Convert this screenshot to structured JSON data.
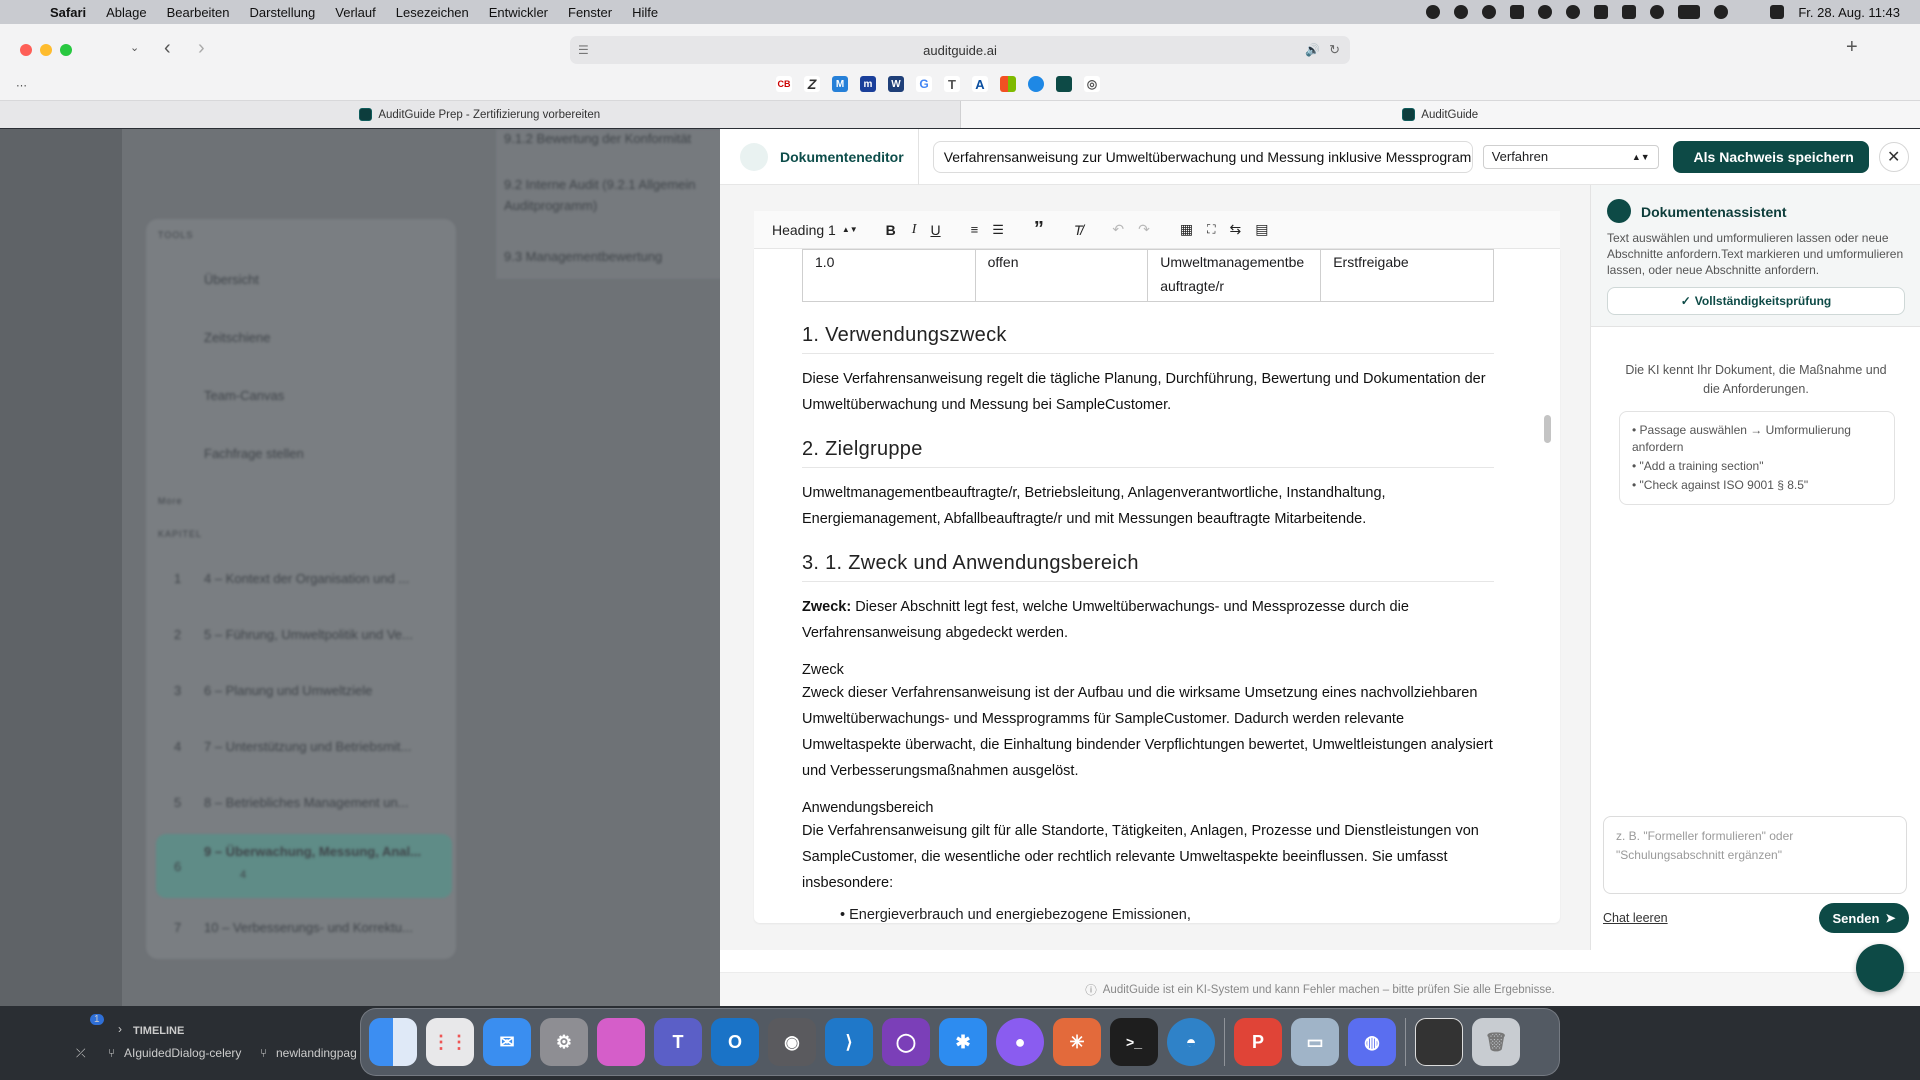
{
  "menubar": {
    "app": "Safari",
    "items": [
      "Ablage",
      "Bearbeiten",
      "Darstellung",
      "Verlauf",
      "Lesezeichen",
      "Entwickler",
      "Fenster",
      "Hilfe"
    ],
    "clock": "Fr. 28. Aug.  11:43"
  },
  "browser": {
    "url": "auditguide.ai",
    "tabs": [
      {
        "label": "AuditGuide Prep - Zertifizierung vorbereiten"
      },
      {
        "label": "AuditGuide"
      }
    ],
    "favorites": [
      "CB",
      "Z",
      "M",
      "m",
      "W",
      "G",
      "T",
      "A",
      "",
      "",
      "",
      ""
    ]
  },
  "background": {
    "top_items": [
      "9.1.2 Bewertung der Konformität",
      "9.2 Interne Audit (9.2.1 Allgemein",
      "Auditprogramm)",
      "9.3 Managementbewertung"
    ],
    "tools_label": "TOOLS",
    "tools": [
      "Übersicht",
      "Zeitschiene",
      "Team-Canvas",
      "Fachfrage stellen"
    ],
    "more_label": "More",
    "chapters_label": "KAPITEL",
    "chapters": [
      {
        "num": "1",
        "label": "4 – Kontext der Organisation und ..."
      },
      {
        "num": "2",
        "label": "5 – Führung, Umweltpolitik und Ve..."
      },
      {
        "num": "3",
        "label": "6 – Planung und Umweltziele"
      },
      {
        "num": "4",
        "label": "7 – Unterstützung und Betriebsmit..."
      },
      {
        "num": "5",
        "label": "8 – Betriebliches Management un..."
      },
      {
        "num": "6",
        "label": "9 – Überwachung, Messung, Anal..."
      },
      {
        "num": "7",
        "label": "10 – Verbesserungs- und Korrektu..."
      }
    ],
    "active_meta": "4"
  },
  "editor": {
    "title": "Dokumenteneditor",
    "doc_title": "Verfahrensanweisung zur Umweltüberwachung und Messung inklusive Messprogramm",
    "doc_type": "Verfahren",
    "save_label": "Als Nachweis speichern",
    "toolbar": {
      "heading": "Heading 1"
    },
    "table_row": [
      "1.0",
      "offen",
      "Umweltmanagementbe auftragte/r",
      "Erstfreigabe"
    ],
    "h1": "1. Verwendungszweck",
    "p1": "Diese Verfahrensanweisung regelt die tägliche Planung, Durchführung, Bewertung und Dokumentation der Umweltüberwachung und Messung bei SampleCustomer.",
    "h2": "2. Zielgruppe",
    "p2": "Umweltmanagementbeauftragte/r, Betriebsleitung, Anlagenverantwortliche, Instandhaltung, Energiemanagement, Abfallbeauftragte/r und mit Messungen beauftragte Mitarbeitende.",
    "h3": "3. 1. Zweck und Anwendungsbereich",
    "p3_bold": "Zweck:",
    "p3": " Dieser Abschnitt legt fest, welche Umweltüberwachungs- und Messprozesse durch die Verfahrensanweisung abgedeckt werden.",
    "sub1": "Zweck",
    "p4": "Zweck dieser Verfahrensanweisung ist der Aufbau und die wirksame Umsetzung eines nachvollziehbaren Umweltüberwachungs- und Messprogramms für SampleCustomer. Dadurch werden relevante Umweltaspekte überwacht, die Einhaltung bindender Verpflichtungen bewertet, Umweltleistungen analysiert und Verbesserungsmaßnahmen ausgelöst.",
    "sub2": "Anwendungsbereich",
    "p5": "Die Verfahrensanweisung gilt für alle Standorte, Tätigkeiten, Anlagen, Prozesse und Dienstleistungen von SampleCustomer, die wesentliche oder rechtlich relevante Umweltaspekte beeinflussen. Sie umfasst insbesondere:",
    "bullet1": "• Energieverbrauch und energiebezogene Emissionen,"
  },
  "assistant": {
    "title": "Dokumentenassistent",
    "desc": "Text auswählen und umformulieren lassen oder neue Abschnitte anfordern.Text markieren und umformulieren lassen, oder neue Abschnitte anfordern.",
    "check_label": "Vollständigkeitsprüfung",
    "info": "Die KI kennt Ihr Dokument, die Maßnahme und die Anforderungen.",
    "hints": [
      "• Passage auswählen → Umformulierung anfordern",
      "• \"Add a training section\"",
      "• \"Check against ISO 9001 § 8.5\""
    ],
    "placeholder": "z. B. \"Formeller formulieren\" oder \"Schulungsabschnitt ergänzen\"",
    "clear_label": "Chat leeren",
    "send_label": "Senden"
  },
  "footer": "AuditGuide ist ein KI-System und kann Fehler machen – bitte prüfen Sie alle Ergebnisse.",
  "taskbar": {
    "badge": "1",
    "timeline": "TIMELINE",
    "branch1": "AIguidedDialog-celery",
    "branch2": "newlandingpag"
  },
  "colors": {
    "accent": "#0d4a46",
    "accent_light": "#e9f2f1"
  }
}
